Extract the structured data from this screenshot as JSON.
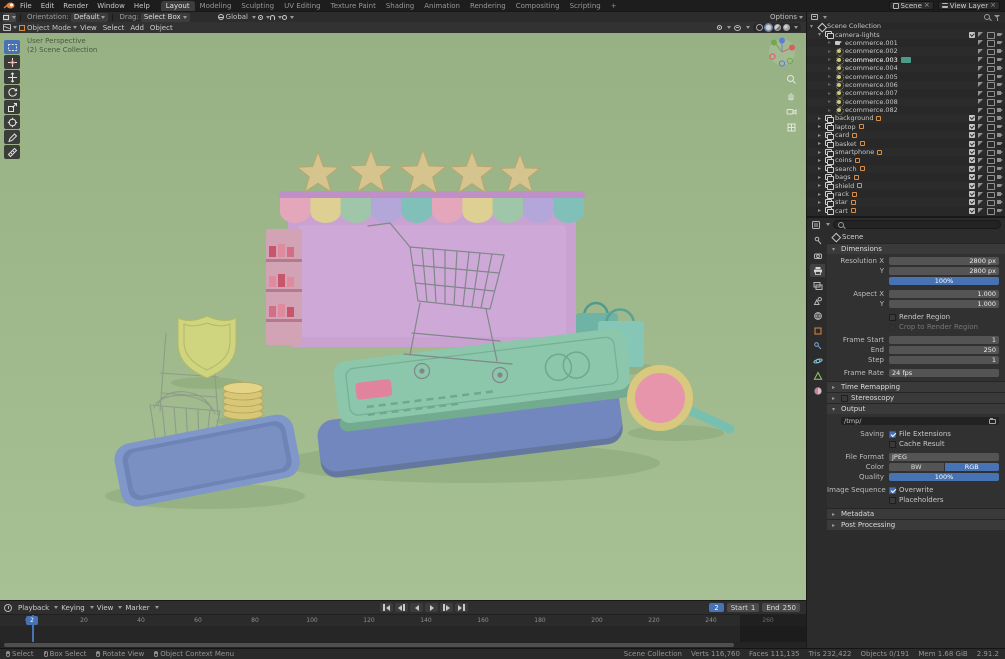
{
  "glyphs": {
    "down": "▾",
    "right": "▸",
    "close": "×"
  },
  "colors": {
    "accent": "#4772b3",
    "viewport_green": "#9db787",
    "topbar": "#1d1d1d"
  },
  "topbar": {
    "menus": [
      "File",
      "Edit",
      "Render",
      "Window",
      "Help"
    ],
    "tabs": [
      "Layout",
      "Modeling",
      "Sculpting",
      "UV Editing",
      "Texture Paint",
      "Shading",
      "Animation",
      "Rendering",
      "Compositing",
      "Scripting"
    ],
    "add_tab": "+",
    "scene_name": "Scene",
    "view_layer_name": "View Layer"
  },
  "tool_settings": {
    "orientation_label": "Orientation:",
    "orientation_value": "Default",
    "drag_label": "Drag:",
    "drag_value": "Select Box",
    "transform_orientation": "Global",
    "options_label": "Options"
  },
  "viewport_header": {
    "mode": "Object Mode",
    "menus": [
      "View",
      "Select",
      "Add",
      "Object"
    ]
  },
  "viewport_overlay": {
    "line1": "User Perspective",
    "line2": "(2) Scene Collection"
  },
  "toolbar_tools": [
    "box-select",
    "cursor",
    "move",
    "rotate",
    "scale",
    "transform",
    "annotate",
    "measure"
  ],
  "outliner": {
    "rows": [
      {
        "label": "Scene Collection",
        "type": "scene"
      },
      {
        "label": "camera-lights",
        "type": "collection"
      },
      {
        "label": "ecommerce.001",
        "type": "camera"
      },
      {
        "label": "ecommerce.002",
        "type": "light"
      },
      {
        "label": "ecommerce.003",
        "type": "light",
        "active": true
      },
      {
        "label": "ecommerce.004",
        "type": "light"
      },
      {
        "label": "ecommerce.005",
        "type": "light"
      },
      {
        "label": "ecommerce.006",
        "type": "light"
      },
      {
        "label": "ecommerce.007",
        "type": "light"
      },
      {
        "label": "ecommerce.008",
        "type": "light"
      },
      {
        "label": "ecommerce.082",
        "type": "light"
      },
      {
        "label": "background",
        "type": "collection"
      },
      {
        "label": "laptop",
        "type": "collection"
      },
      {
        "label": "card",
        "type": "collection"
      },
      {
        "label": "basket",
        "type": "collection"
      },
      {
        "label": "smartphone",
        "type": "collection"
      },
      {
        "label": "coins",
        "type": "collection"
      },
      {
        "label": "search",
        "type": "collection"
      },
      {
        "label": "bags",
        "type": "collection"
      },
      {
        "label": "shield",
        "type": "collection"
      },
      {
        "label": "rack",
        "type": "collection"
      },
      {
        "label": "star",
        "type": "collection"
      },
      {
        "label": "cart",
        "type": "collection"
      }
    ]
  },
  "props": {
    "breadcrumb": "Scene",
    "tab_names": [
      "tool",
      "render",
      "output",
      "view-layer",
      "scene",
      "world",
      "object",
      "modifiers",
      "physics",
      "object-data",
      "material"
    ],
    "dim_title": "Dimensions",
    "res_x_l": "Resolution X",
    "res_x_v": "2800 px",
    "res_y_l": "Y",
    "res_y_v": "2800 px",
    "pct_v": "100%",
    "asp_x_l": "Aspect X",
    "asp_x_v": "1.000",
    "asp_y_l": "Y",
    "asp_y_v": "1.000",
    "render_region_l": "Render Region",
    "crop_l": "Crop to Render Region",
    "fs_l": "Frame Start",
    "fs_v": "1",
    "fe_l": "End",
    "fe_v": "250",
    "fstep_l": "Step",
    "fstep_v": "1",
    "fr_l": "Frame Rate",
    "fr_v": "24 fps",
    "time_remap": "Time Remapping",
    "stereo": "Stereoscopy",
    "out_title": "Output",
    "out_path": "/tmp/",
    "saving_l": "Saving",
    "file_ext_l": "File Extensions",
    "cache_l": "Cache Result",
    "format_l": "File Format",
    "format_v": "JPEG",
    "color_l": "Color",
    "color_bw": "BW",
    "color_rgb": "RGB",
    "quality_l": "Quality",
    "quality_v": "100%",
    "imgseq_l": "Image Sequence",
    "overwrite_l": "Overwrite",
    "placeholders_l": "Placeholders",
    "metadata": "Metadata",
    "postproc": "Post Processing"
  },
  "timeline": {
    "menus": [
      "Playback",
      "Keying",
      "View",
      "Marker"
    ],
    "frame": "2",
    "start_l": "Start",
    "start_v": "1",
    "end_l": "End",
    "end_v": "250",
    "ticks": [
      "0",
      "20",
      "40",
      "60",
      "80",
      "100",
      "120",
      "140",
      "160",
      "180",
      "200",
      "220",
      "240",
      "260"
    ]
  },
  "statusbar": {
    "hints": [
      "Select",
      "Box Select",
      "Rotate View",
      "Object Context Menu"
    ],
    "stats": [
      "Scene Collection",
      "Verts 116,760",
      "Faces 111,135",
      "Tris 232,422",
      "Objects 0/191",
      "Mem 1.68 GiB",
      "2.91.2"
    ]
  }
}
